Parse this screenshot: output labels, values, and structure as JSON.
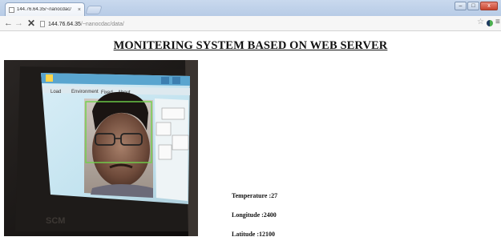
{
  "browser": {
    "tab_title": "144.76.64.35/~nanocdac/",
    "tab_close": "×",
    "url_host": "144.76.64.35",
    "url_path": "/~nanocdac/data/",
    "window_controls": {
      "minimize": "–",
      "maximize": "□",
      "close": "x"
    },
    "nav": {
      "back": "←",
      "forward": "→",
      "stop": "✕"
    },
    "icons": [
      "page-icon",
      "star-icon",
      "extension-icon",
      "menu-icon"
    ]
  },
  "page": {
    "title": "MONITERING SYSTEM BASED ON WEB SERVER",
    "camera_caption": "Live camera image showing a person's face with a green face-detection rectangle; the device screen shows menu items and buttons.",
    "readings": [
      {
        "label": "Temperature :",
        "value": "27"
      },
      {
        "label": "Longitude :",
        "value": "2400"
      },
      {
        "label": "Latitude :",
        "value": "12100"
      }
    ]
  },
  "colors": {
    "tabbar": "#c2d4ec",
    "toolbar": "#f6f6f6",
    "detection_box": "#6fd24a"
  }
}
